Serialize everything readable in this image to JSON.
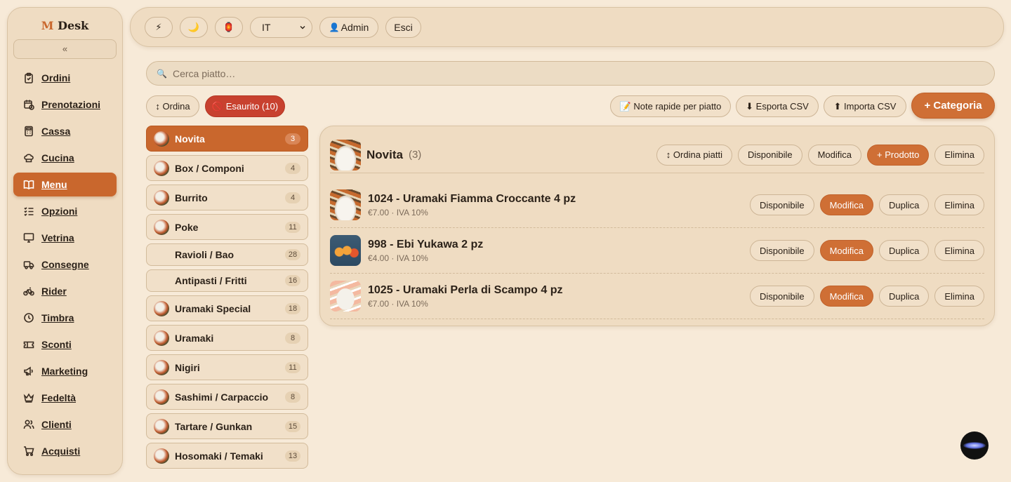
{
  "sidebar": {
    "logo_m": "M",
    "logo_text": "Desk",
    "collapse": "«",
    "items": [
      {
        "label": "Ordini",
        "icon": "clipboard-icon"
      },
      {
        "label": "Prenotazioni",
        "icon": "calendar-clock-icon"
      },
      {
        "label": "Cassa",
        "icon": "calculator-icon"
      },
      {
        "label": "Cucina",
        "icon": "chef-hat-icon"
      },
      {
        "label": "Menu",
        "icon": "book-open-icon",
        "active": true
      },
      {
        "label": "Opzioni",
        "icon": "list-check-icon"
      },
      {
        "label": "Vetrina",
        "icon": "monitor-icon"
      },
      {
        "label": "Consegne",
        "icon": "truck-icon"
      },
      {
        "label": "Rider",
        "icon": "bike-icon"
      },
      {
        "label": "Timbra",
        "icon": "clock-icon"
      },
      {
        "label": "Sconti",
        "icon": "ticket-icon"
      },
      {
        "label": "Marketing",
        "icon": "megaphone-icon"
      },
      {
        "label": "Fedeltà",
        "icon": "crown-icon"
      },
      {
        "label": "Clienti",
        "icon": "users-icon"
      },
      {
        "label": "Acquisti",
        "icon": "cart-icon"
      }
    ]
  },
  "topbar": {
    "flash_icon": "⚡",
    "moon_icon": "🌙",
    "lantern_icon": "🏮",
    "language": "IT",
    "admin_icon": "👤",
    "admin_label": "Admin",
    "logout_label": "Esci"
  },
  "search": {
    "icon": "🔍",
    "placeholder": "Cerca piatto…"
  },
  "actions": {
    "sort_label": "↕ Ordina",
    "soldout_label": "🚫 Esaurito (10)",
    "notes_label": "📝 Note rapide per piatto",
    "export_label": "⬇ Esporta CSV",
    "import_label": "⬆ Importa CSV",
    "add_category_label": "+ Categoria"
  },
  "categories": [
    {
      "name": "Novita",
      "count": "3",
      "active": true,
      "thumb": true
    },
    {
      "name": "Box / Componi",
      "count": "4",
      "thumb": true
    },
    {
      "name": "Burrito",
      "count": "4",
      "thumb": true
    },
    {
      "name": "Poke",
      "count": "11",
      "thumb": true
    },
    {
      "name": "Ravioli / Bao",
      "count": "28",
      "thumb": false
    },
    {
      "name": "Antipasti / Fritti",
      "count": "16",
      "thumb": false
    },
    {
      "name": "Uramaki Special",
      "count": "18",
      "thumb": true
    },
    {
      "name": "Uramaki",
      "count": "8",
      "thumb": true
    },
    {
      "name": "Nigiri",
      "count": "11",
      "thumb": true
    },
    {
      "name": "Sashimi / Carpaccio",
      "count": "8",
      "thumb": true
    },
    {
      "name": "Tartare / Gunkan",
      "count": "15",
      "thumb": true
    },
    {
      "name": "Hosomaki / Temaki",
      "count": "13",
      "thumb": true
    }
  ],
  "panel": {
    "title": "Novita",
    "count": "(3)",
    "sort_dishes_label": "↕ Ordina piatti",
    "available_label": "Disponibile",
    "edit_label": "Modifica",
    "add_product_label": "+ Prodotto",
    "delete_label": "Elimina",
    "products": [
      {
        "name": "1024 - Uramaki Fiamma Croccante 4 pz",
        "price": "€7.00 · IVA 10%",
        "thumb": "t1"
      },
      {
        "name": "998 - Ebi Yukawa 2 pz",
        "price": "€4.00 · IVA 10%",
        "thumb": "t2"
      },
      {
        "name": "1025 - Uramaki Perla di Scampo 4 pz",
        "price": "€7.00 · IVA 10%",
        "thumb": "t3"
      }
    ],
    "row_buttons": {
      "available": "Disponibile",
      "edit": "Modifica",
      "duplicate": "Duplica",
      "delete": "Elimina"
    }
  }
}
